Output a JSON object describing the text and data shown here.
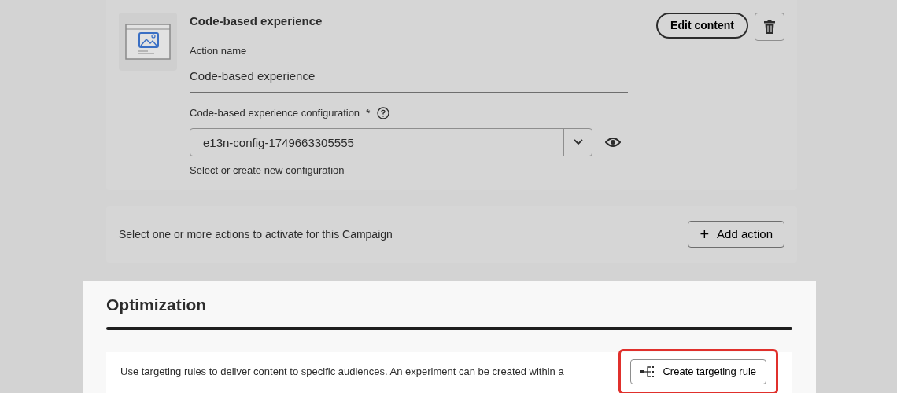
{
  "action_card": {
    "title": "Code-based experience",
    "name_label": "Action name",
    "name_value": "Code-based experience",
    "config_label": "Code-based experience configuration",
    "required_mark": "*",
    "config_value": "e13n-config-1749663305555",
    "config_help": "Select or create new configuration",
    "edit_button": "Edit content"
  },
  "add_action_card": {
    "text": "Select one or more actions to activate for this Campaign",
    "plus": "+",
    "button": "Add action"
  },
  "optimization": {
    "title": "Optimization",
    "description": "Use targeting rules to deliver content to specific audiences. An experiment can be created within a",
    "button": {
      "label": "Create targeting rule",
      "highlighted": true
    }
  }
}
